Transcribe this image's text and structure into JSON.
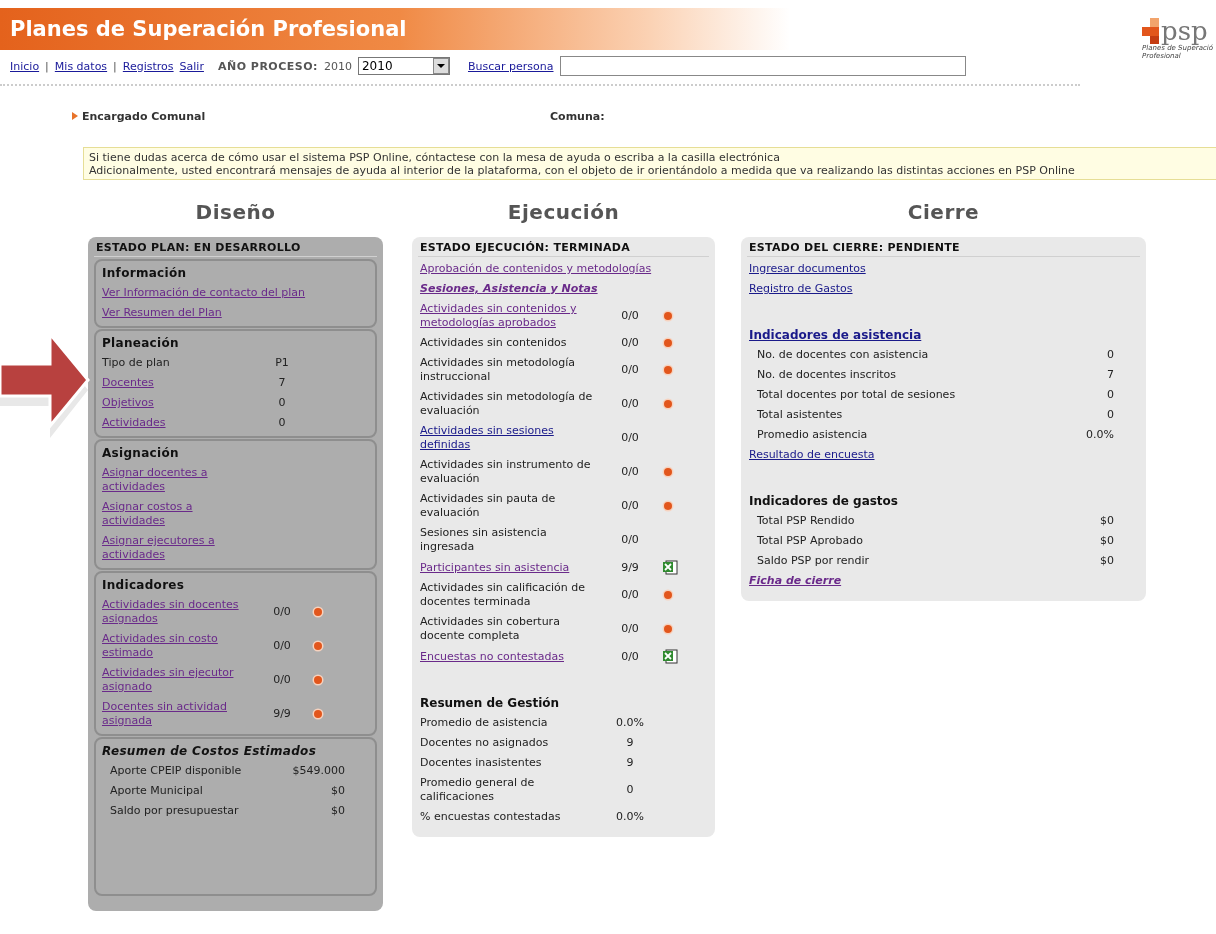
{
  "header": {
    "title": "Planes de Superación Profesional",
    "separator": "|",
    "nav": [
      {
        "label": "Inicio"
      },
      {
        "label": "Mis datos"
      },
      {
        "label": "Registros"
      },
      {
        "label": "Salir"
      }
    ],
    "year_label": "AÑO PROCESO:",
    "year_value": "2010",
    "year_select": "2010",
    "search_link": "Buscar persona",
    "logo": {
      "mark": "psp",
      "tagline": [
        "Planes de Superació",
        "Profesional"
      ]
    }
  },
  "context": {
    "role": "Encargado Comunal",
    "commune_label": "Comuna:"
  },
  "notice": [
    "Si tiene dudas acerca de cómo usar el sistema PSP Online, cóntactese con la mesa de ayuda o escriba a la casilla electrónica",
    "Adicionalmente, usted encontrará mensajes de ayuda al interior de la plataforma, con el objeto de ir orientándolo a medida que va realizando las distintas acciones en PSP Online"
  ],
  "columns": [
    {
      "title": "Diseño",
      "status": "ESTADO PLAN: EN DESARROLLO",
      "sections": [
        {
          "heading": "Información",
          "italic": false,
          "items": [
            {
              "kind": "link",
              "label": "Ver Información de contacto del plan",
              "visited": true
            },
            {
              "kind": "link",
              "label": "Ver Resumen del Plan",
              "visited": true
            }
          ]
        },
        {
          "heading": "Planeación",
          "italic": false,
          "items": [
            {
              "kind": "row",
              "label": "Tipo de plan",
              "link": false,
              "value": "P1"
            },
            {
              "kind": "row",
              "label": "Docentes",
              "link": true,
              "visited": true,
              "value": "7"
            },
            {
              "kind": "row",
              "label": "Objetivos",
              "link": true,
              "visited": true,
              "value": "0"
            },
            {
              "kind": "row",
              "label": "Actividades",
              "link": true,
              "visited": true,
              "value": "0"
            }
          ]
        },
        {
          "heading": "Asignación",
          "italic": false,
          "items": [
            {
              "kind": "row",
              "label": "Asignar docentes a actividades",
              "link": true,
              "visited": true
            },
            {
              "kind": "row",
              "label": "Asignar costos a actividades",
              "link": true,
              "visited": true
            },
            {
              "kind": "row",
              "label": "Asignar ejecutores a actividades",
              "link": true,
              "visited": true
            }
          ]
        },
        {
          "heading": "Indicadores",
          "italic": false,
          "items": [
            {
              "kind": "alert",
              "label": "Actividades sin docentes asignados",
              "link": true,
              "visited": true,
              "value": "0/0"
            },
            {
              "kind": "alert",
              "label": "Actividades sin costo estimado",
              "link": true,
              "visited": true,
              "value": "0/0"
            },
            {
              "kind": "alert",
              "label": "Actividades sin ejecutor asignado",
              "link": true,
              "visited": true,
              "value": "0/0"
            },
            {
              "kind": "alert",
              "label": "Docentes sin actividad asignada",
              "link": true,
              "visited": true,
              "value": "9/9"
            }
          ]
        },
        {
          "heading": "Resumen de Costos Estimados",
          "italic": true,
          "items": [
            {
              "kind": "stat",
              "label": "Aporte CPEIP disponible",
              "value": "$549.000"
            },
            {
              "kind": "stat",
              "label": "Aporte Municipal",
              "value": "$0"
            },
            {
              "kind": "stat",
              "label": "Saldo por presupuestar",
              "value": "$0"
            }
          ]
        }
      ]
    },
    {
      "title": "Ejecución",
      "status": "ESTADO EJECUCIÓN: TERMINADA",
      "sections": [
        {
          "items": [
            {
              "kind": "link",
              "label": "Aprobación de contenidos y metodologías",
              "visited": true
            },
            {
              "kind": "link",
              "label": "Sesiones, Asistencia y Notas",
              "visited": true,
              "emphasis": true
            },
            {
              "kind": "alert",
              "label": "Actividades sin contenidos y metodologías aprobados",
              "link": true,
              "visited": true,
              "value": "0/0"
            },
            {
              "kind": "alert",
              "label": "Actividades sin contenidos",
              "link": false,
              "value": "0/0"
            },
            {
              "kind": "alert",
              "label": "Actividades sin metodología instruccional",
              "link": false,
              "value": "0/0"
            },
            {
              "kind": "alert",
              "label": "Actividades sin metodología de evaluación",
              "link": false,
              "value": "0/0"
            },
            {
              "kind": "row",
              "label": "Actividades sin sesiones definidas",
              "link": true,
              "visited": false,
              "value": "0/0"
            },
            {
              "kind": "alert",
              "label": "Actividades sin instrumento de evaluación",
              "link": false,
              "value": "0/0"
            },
            {
              "kind": "alert",
              "label": "Actividades sin pauta de evaluación",
              "link": false,
              "value": "0/0"
            },
            {
              "kind": "row",
              "label": "Sesiones sin asistencia ingresada",
              "link": false,
              "value": "0/0"
            },
            {
              "kind": "export",
              "label": "Participantes sin asistencia",
              "link": true,
              "visited": true,
              "value": "9/9"
            },
            {
              "kind": "alert",
              "label": "Actividades sin calificación de docentes terminada",
              "link": false,
              "value": "0/0"
            },
            {
              "kind": "alert",
              "label": "Actividades sin cobertura docente completa",
              "link": false,
              "value": "0/0"
            },
            {
              "kind": "export",
              "label": "Encuestas no contestadas",
              "link": true,
              "visited": true,
              "value": "0/0"
            },
            {
              "kind": "title",
              "label": "Resumen de Gestión",
              "link": false
            },
            {
              "kind": "row",
              "label": "Promedio de asistencia",
              "link": false,
              "value": "0.0%"
            },
            {
              "kind": "row",
              "label": "Docentes no asignados",
              "link": false,
              "value": "9"
            },
            {
              "kind": "row",
              "label": "Docentes inasistentes",
              "link": false,
              "value": "9"
            },
            {
              "kind": "row",
              "label": "Promedio general de calificaciones",
              "link": false,
              "value": "0"
            },
            {
              "kind": "row",
              "label": "% encuestas contestadas",
              "link": false,
              "value": "0.0%"
            }
          ]
        }
      ]
    },
    {
      "title": "Cierre",
      "status": "ESTADO DEL CIERRE: PENDIENTE",
      "sections": [
        {
          "items": [
            {
              "kind": "link",
              "label": "Ingresar documentos",
              "visited": false
            },
            {
              "kind": "link",
              "label": "Registro de Gastos",
              "visited": false
            },
            {
              "kind": "title",
              "label": "Indicadores de asistencia",
              "link": true,
              "visited": false
            },
            {
              "kind": "stat",
              "label": "No. de docentes con asistencia",
              "value": "0"
            },
            {
              "kind": "stat",
              "label": "No. de docentes inscritos",
              "value": "7"
            },
            {
              "kind": "stat",
              "label": "Total docentes por total de sesiones",
              "value": "0"
            },
            {
              "kind": "stat",
              "label": "Total asistentes",
              "value": "0"
            },
            {
              "kind": "stat",
              "label": "Promedio asistencia",
              "value": "0.0%"
            },
            {
              "kind": "link",
              "label": "Resultado de encuesta",
              "visited": false
            },
            {
              "kind": "title",
              "label": "Indicadores de gastos",
              "link": false
            },
            {
              "kind": "stat",
              "label": "Total PSP Rendido",
              "value": "$0"
            },
            {
              "kind": "stat",
              "label": "Total PSP Aprobado",
              "value": "$0"
            },
            {
              "kind": "stat",
              "label": "Saldo PSP por rendir",
              "value": "$0"
            },
            {
              "kind": "link",
              "label": "Ficha de cierre",
              "visited": true,
              "emphasis": true
            }
          ]
        }
      ]
    }
  ]
}
